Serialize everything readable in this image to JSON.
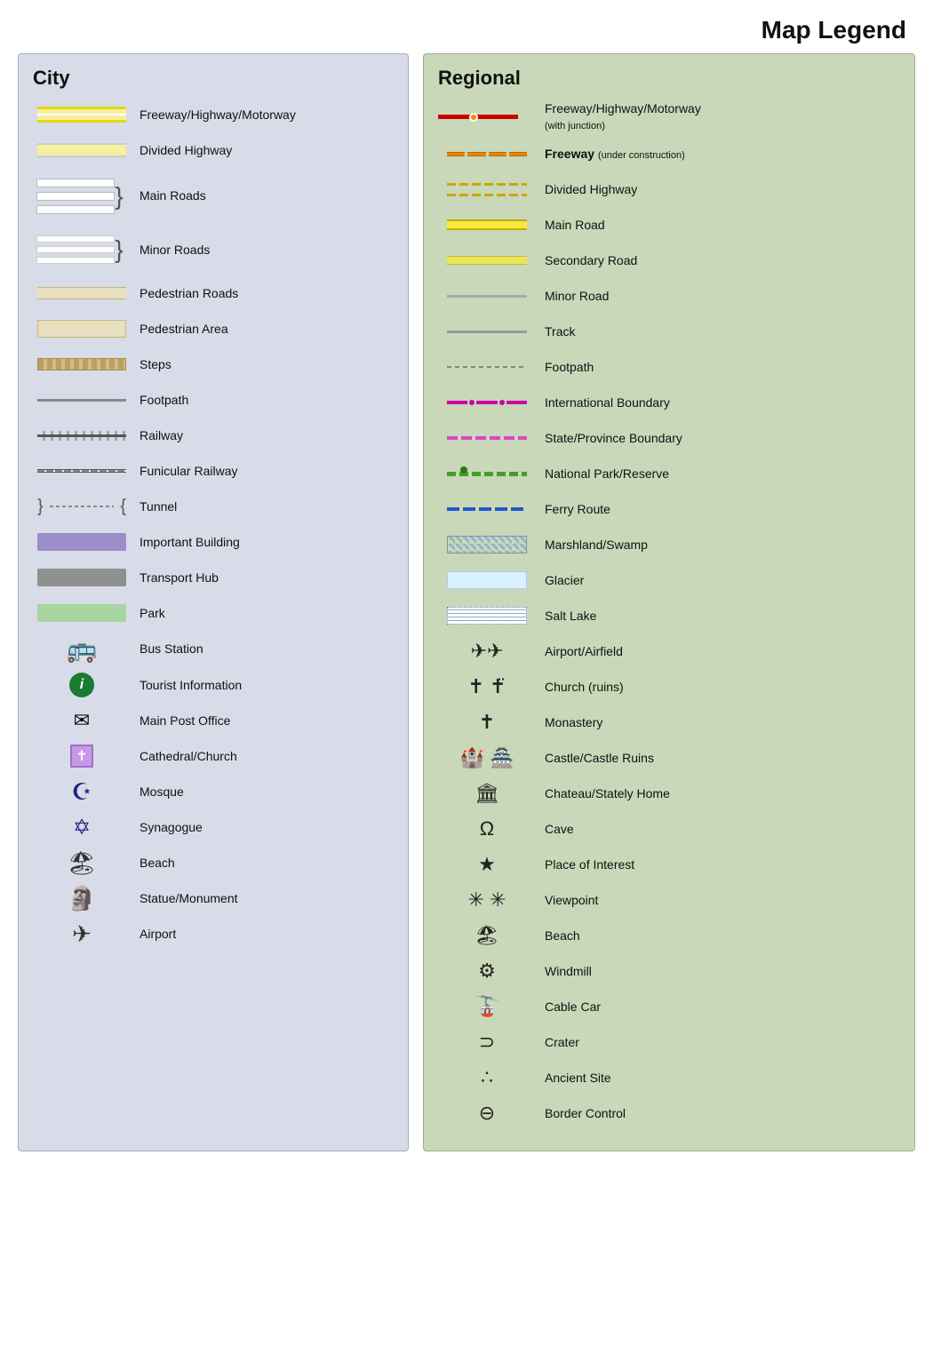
{
  "title": "Map Legend",
  "city": {
    "title": "City",
    "items": [
      {
        "id": "city-freeway",
        "label": "Freeway/Highway/Motorway",
        "symbol": "freeway"
      },
      {
        "id": "city-divided-hwy",
        "label": "Divided Highway",
        "symbol": "divided"
      },
      {
        "id": "city-main-roads",
        "label": "Main Roads",
        "symbol": "main-roads"
      },
      {
        "id": "city-minor-roads",
        "label": "Minor Roads",
        "symbol": "minor-roads"
      },
      {
        "id": "city-ped-roads",
        "label": "Pedestrian Roads",
        "symbol": "ped-roads"
      },
      {
        "id": "city-ped-area",
        "label": "Pedestrian Area",
        "symbol": "ped-area"
      },
      {
        "id": "city-steps",
        "label": "Steps",
        "symbol": "steps"
      },
      {
        "id": "city-footpath",
        "label": "Footpath",
        "symbol": "footpath"
      },
      {
        "id": "city-railway",
        "label": "Railway",
        "symbol": "railway"
      },
      {
        "id": "city-funicular",
        "label": "Funicular Railway",
        "symbol": "funicular"
      },
      {
        "id": "city-tunnel",
        "label": "Tunnel",
        "symbol": "tunnel"
      },
      {
        "id": "city-important",
        "label": "Important Building",
        "symbol": "important"
      },
      {
        "id": "city-transport",
        "label": "Transport Hub",
        "symbol": "transport"
      },
      {
        "id": "city-park",
        "label": "Park",
        "symbol": "park"
      },
      {
        "id": "city-bus",
        "label": "Bus Station",
        "symbol": "bus"
      },
      {
        "id": "city-tourist",
        "label": "Tourist Information",
        "symbol": "tourist"
      },
      {
        "id": "city-post",
        "label": "Main Post Office",
        "symbol": "post"
      },
      {
        "id": "city-cathedral",
        "label": "Cathedral/Church",
        "symbol": "cathedral"
      },
      {
        "id": "city-mosque",
        "label": "Mosque",
        "symbol": "mosque"
      },
      {
        "id": "city-synagogue",
        "label": "Synagogue",
        "symbol": "synagogue"
      },
      {
        "id": "city-beach",
        "label": "Beach",
        "symbol": "beach"
      },
      {
        "id": "city-statue",
        "label": "Statue/Monument",
        "symbol": "statue"
      },
      {
        "id": "city-airport",
        "label": "Airport",
        "symbol": "airport"
      }
    ]
  },
  "regional": {
    "title": "Regional",
    "items": [
      {
        "id": "reg-freeway",
        "label": "Freeway/Highway/Motorway",
        "sublabel": "(with junction)",
        "symbol": "reg-freeway"
      },
      {
        "id": "reg-freeway-uc",
        "label": "Freeway",
        "sublabel": "(under construction)",
        "symbol": "reg-freeway-uc"
      },
      {
        "id": "reg-divided",
        "label": "Divided Highway",
        "symbol": "reg-divided"
      },
      {
        "id": "reg-main",
        "label": "Main Road",
        "symbol": "reg-main"
      },
      {
        "id": "reg-secondary",
        "label": "Secondary Road",
        "symbol": "reg-secondary"
      },
      {
        "id": "reg-minor",
        "label": "Minor Road",
        "symbol": "reg-minor"
      },
      {
        "id": "reg-track",
        "label": "Track",
        "symbol": "reg-track"
      },
      {
        "id": "reg-footpath",
        "label": "Footpath",
        "symbol": "reg-footpath"
      },
      {
        "id": "reg-intl",
        "label": "International Boundary",
        "symbol": "reg-intl"
      },
      {
        "id": "reg-state",
        "label": "State/Province Boundary",
        "symbol": "reg-state"
      },
      {
        "id": "reg-natpark",
        "label": "National Park/Reserve",
        "symbol": "reg-natpark"
      },
      {
        "id": "reg-ferry",
        "label": "Ferry Route",
        "symbol": "reg-ferry"
      },
      {
        "id": "reg-marsh",
        "label": "Marshland/Swamp",
        "symbol": "reg-marsh"
      },
      {
        "id": "reg-glacier",
        "label": "Glacier",
        "symbol": "reg-glacier"
      },
      {
        "id": "reg-saltlake",
        "label": "Salt Lake",
        "symbol": "reg-saltlake"
      },
      {
        "id": "reg-airport",
        "label": "Airport/Airfield",
        "symbol": "reg-airport"
      },
      {
        "id": "reg-church",
        "label": "Church (ruins)",
        "symbol": "reg-church"
      },
      {
        "id": "reg-monastery",
        "label": "Monastery",
        "symbol": "reg-monastery"
      },
      {
        "id": "reg-castle",
        "label": "Castle/Castle Ruins",
        "symbol": "reg-castle"
      },
      {
        "id": "reg-chateau",
        "label": "Chateau/Stately Home",
        "symbol": "reg-chateau"
      },
      {
        "id": "reg-cave",
        "label": "Cave",
        "symbol": "reg-cave"
      },
      {
        "id": "reg-poi",
        "label": "Place of Interest",
        "symbol": "reg-poi"
      },
      {
        "id": "reg-viewpoint",
        "label": "Viewpoint",
        "symbol": "reg-viewpoint"
      },
      {
        "id": "reg-beach",
        "label": "Beach",
        "symbol": "reg-beach"
      },
      {
        "id": "reg-windmill",
        "label": "Windmill",
        "symbol": "reg-windmill"
      },
      {
        "id": "reg-cablecar",
        "label": "Cable Car",
        "symbol": "reg-cablecar"
      },
      {
        "id": "reg-crater",
        "label": "Crater",
        "symbol": "reg-crater"
      },
      {
        "id": "reg-ancient",
        "label": "Ancient Site",
        "symbol": "reg-ancient"
      },
      {
        "id": "reg-border",
        "label": "Border Control",
        "symbol": "reg-border"
      }
    ]
  }
}
